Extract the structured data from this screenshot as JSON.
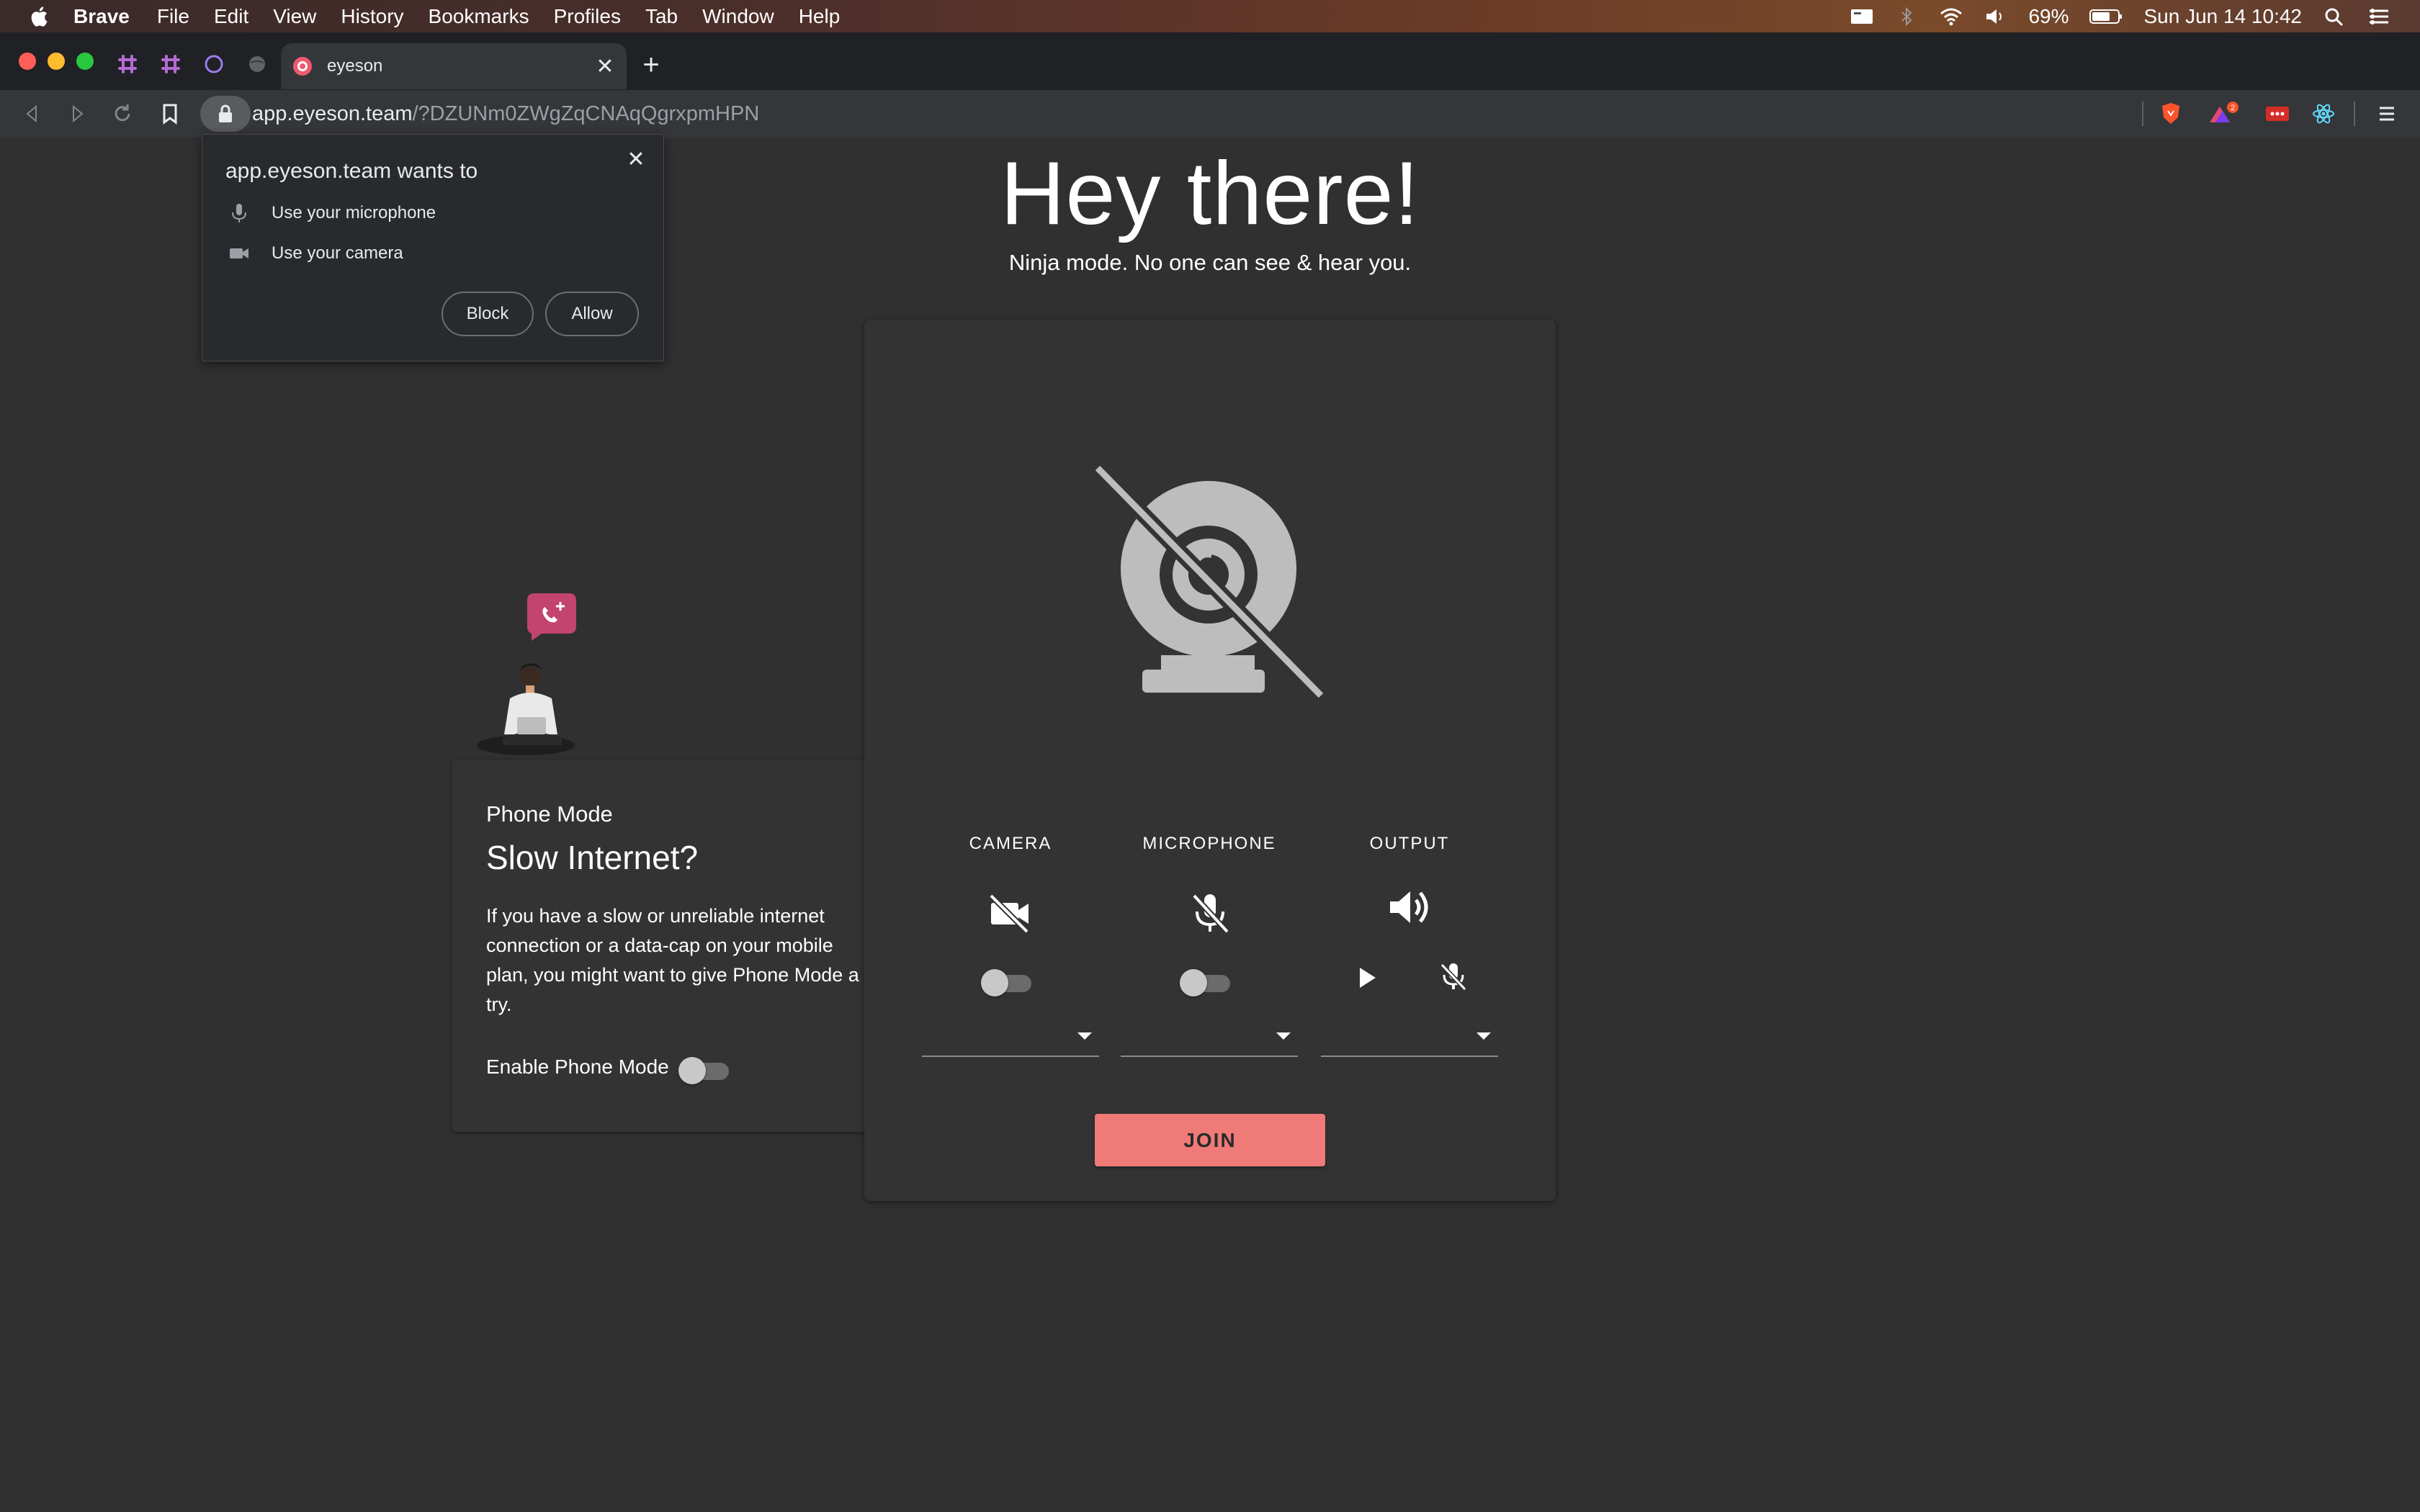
{
  "menubar": {
    "app_name": "Brave",
    "items": [
      "File",
      "Edit",
      "View",
      "History",
      "Bookmarks",
      "Profiles",
      "Tab",
      "Window",
      "Help"
    ],
    "battery": "69%",
    "datetime": "Sun Jun 14  10:42"
  },
  "browser": {
    "tab_title": "eyeson",
    "url_host": "app.eyeson.team",
    "url_path": "/?DZUNm0ZWgZqCNAqQgrxpmHPN",
    "brave_badge_count": "2"
  },
  "permission_popup": {
    "title": "app.eyeson.team wants to",
    "microphone": "Use your microphone",
    "camera": "Use your camera",
    "block_label": "Block",
    "allow_label": "Allow"
  },
  "header": {
    "title": "Hey there!",
    "subtitle": "Ninja mode. No one can see & hear you."
  },
  "phone_mode": {
    "overline": "Phone Mode",
    "title": "Slow Internet?",
    "description": "If you have a slow or unreliable internet connection or a data-cap on your mobile plan, you might want to give Phone Mode a try.",
    "enable_label": "Enable Phone Mode",
    "enabled": false
  },
  "devices": {
    "camera": {
      "label": "CAMERA",
      "enabled": false,
      "selected": ""
    },
    "microphone": {
      "label": "MICROPHONE",
      "enabled": false,
      "selected": ""
    },
    "output": {
      "label": "OUTPUT",
      "selected": ""
    }
  },
  "join_label": "JOIN",
  "colors": {
    "accent": "#ef7a78",
    "background": "#303030",
    "card": "#333333",
    "icon_grey": "#bdbdbd"
  }
}
